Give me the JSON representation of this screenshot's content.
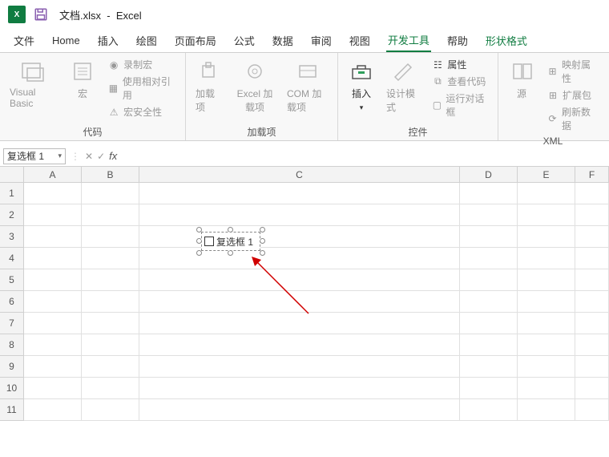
{
  "titlebar": {
    "filename": "文档.xlsx",
    "sep": "-",
    "app": "Excel"
  },
  "tabs": {
    "file": "文件",
    "home": "Home",
    "insert": "插入",
    "draw": "绘图",
    "layout": "页面布局",
    "formula": "公式",
    "data": "数据",
    "review": "审阅",
    "view": "视图",
    "dev": "开发工具",
    "help": "帮助",
    "shapefmt": "形状格式"
  },
  "ribbon": {
    "code": {
      "vb": "Visual Basic",
      "macro": "宏",
      "record": "录制宏",
      "relref": "使用相对引用",
      "security": "宏安全性",
      "label": "代码"
    },
    "addins": {
      "addin": "加载项",
      "excel": "Excel 加载项",
      "com": "COM 加载项",
      "label": "加载项"
    },
    "controls": {
      "insert": "插入",
      "design": "设计模式",
      "props": "属性",
      "viewcode": "查看代码",
      "rundialog": "运行对话框",
      "label": "控件"
    },
    "xml": {
      "source": "源",
      "mapprops": "映射属性",
      "expand": "扩展包",
      "refresh": "刷新数据",
      "label": "XML"
    }
  },
  "namebox": {
    "value": "复选框 1"
  },
  "cols": [
    "A",
    "B",
    "C",
    "D",
    "E",
    "F"
  ],
  "rows": [
    "1",
    "2",
    "3",
    "4",
    "5",
    "6",
    "7",
    "8",
    "9",
    "10",
    "11"
  ],
  "object": {
    "label": "复选框 1"
  }
}
